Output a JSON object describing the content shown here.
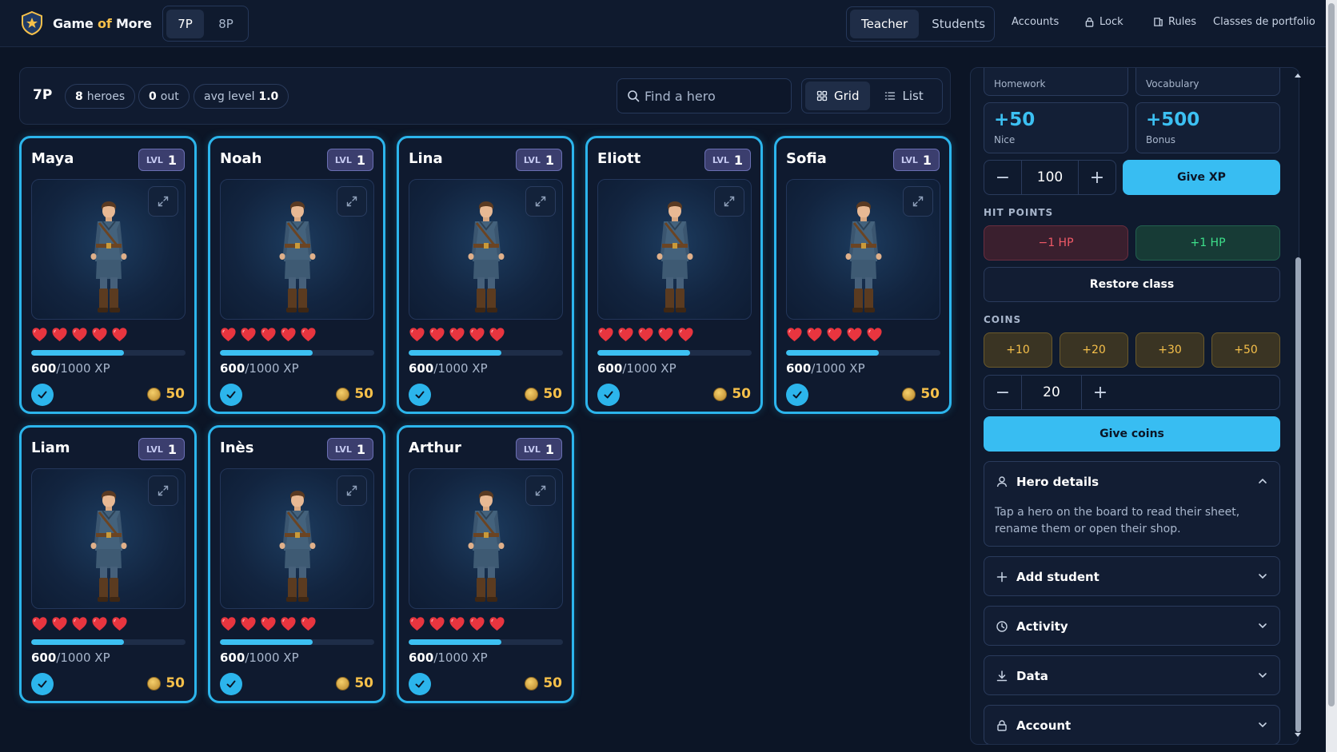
{
  "app": {
    "name_part1": "Game ",
    "name_of": "of",
    "name_part2": " More",
    "classes": [
      "7P",
      "8P"
    ],
    "active_class": "7P"
  },
  "nav": {
    "modes": [
      "Teacher",
      "Students"
    ],
    "active_mode": "Teacher",
    "accounts": "Accounts",
    "lock": "Lock",
    "rules": "Rules",
    "portfolio": "Classes de portfolio"
  },
  "toolbar": {
    "class_label": "7P",
    "heroes_count": "8",
    "heroes_text": "heroes",
    "out_count": "0",
    "out_text": "out",
    "avg_text": "avg level",
    "avg_value": "1.0",
    "search_placeholder": "Find a hero",
    "grid_label": "Grid",
    "list_label": "List",
    "active_view": "Grid"
  },
  "heroes": [
    {
      "name": "Maya",
      "lvl_label": "LVL",
      "level": "1",
      "hearts": 5,
      "xp": "600",
      "xp_max": "/1000 XP",
      "xp_fraction": 0.6,
      "coins": "50"
    },
    {
      "name": "Noah",
      "lvl_label": "LVL",
      "level": "1",
      "hearts": 5,
      "xp": "600",
      "xp_max": "/1000 XP",
      "xp_fraction": 0.6,
      "coins": "50"
    },
    {
      "name": "Lina",
      "lvl_label": "LVL",
      "level": "1",
      "hearts": 5,
      "xp": "600",
      "xp_max": "/1000 XP",
      "xp_fraction": 0.6,
      "coins": "50"
    },
    {
      "name": "Eliott",
      "lvl_label": "LVL",
      "level": "1",
      "hearts": 5,
      "xp": "600",
      "xp_max": "/1000 XP",
      "xp_fraction": 0.6,
      "coins": "50"
    },
    {
      "name": "Sofia",
      "lvl_label": "LVL",
      "level": "1",
      "hearts": 5,
      "xp": "600",
      "xp_max": "/1000 XP",
      "xp_fraction": 0.6,
      "coins": "50"
    },
    {
      "name": "Liam",
      "lvl_label": "LVL",
      "level": "1",
      "hearts": 5,
      "xp": "600",
      "xp_max": "/1000 XP",
      "xp_fraction": 0.6,
      "coins": "50"
    },
    {
      "name": "Inès",
      "lvl_label": "LVL",
      "level": "1",
      "hearts": 5,
      "xp": "600",
      "xp_max": "/1000 XP",
      "xp_fraction": 0.6,
      "coins": "50"
    },
    {
      "name": "Arthur",
      "lvl_label": "LVL",
      "level": "1",
      "hearts": 5,
      "xp": "600",
      "xp_max": "/1000 XP",
      "xp_fraction": 0.6,
      "coins": "50"
    }
  ],
  "side": {
    "preset_top": [
      "Homework",
      "Vocabulary"
    ],
    "xp_presets": [
      {
        "value": "+50",
        "label": "Nice"
      },
      {
        "value": "+500",
        "label": "Bonus"
      }
    ],
    "xp_amount": "100",
    "give_xp": "Give XP",
    "hp_title": "HIT POINTS",
    "minus_hp": "−1 HP",
    "plus_hp": "+1 HP",
    "restore": "Restore class",
    "coins_title": "COINS",
    "coin_presets": [
      "+10",
      "+20",
      "+30",
      "+50"
    ],
    "coin_amount": "20",
    "give_coins": "Give coins",
    "hero_details_title": "Hero details",
    "hero_details_body": "Tap a hero on the board to read their sheet, rename them or open their shop.",
    "add_student": "Add student",
    "activity": "Activity",
    "data": "Data",
    "account": "Account"
  },
  "colors": {
    "accent": "#38bdf2",
    "card_border": "#2cb5ec",
    "gold": "#f6c04a",
    "heart": "#e8353f",
    "hp_minus_text": "#f05a67",
    "hp_plus_text": "#3ee08a"
  }
}
